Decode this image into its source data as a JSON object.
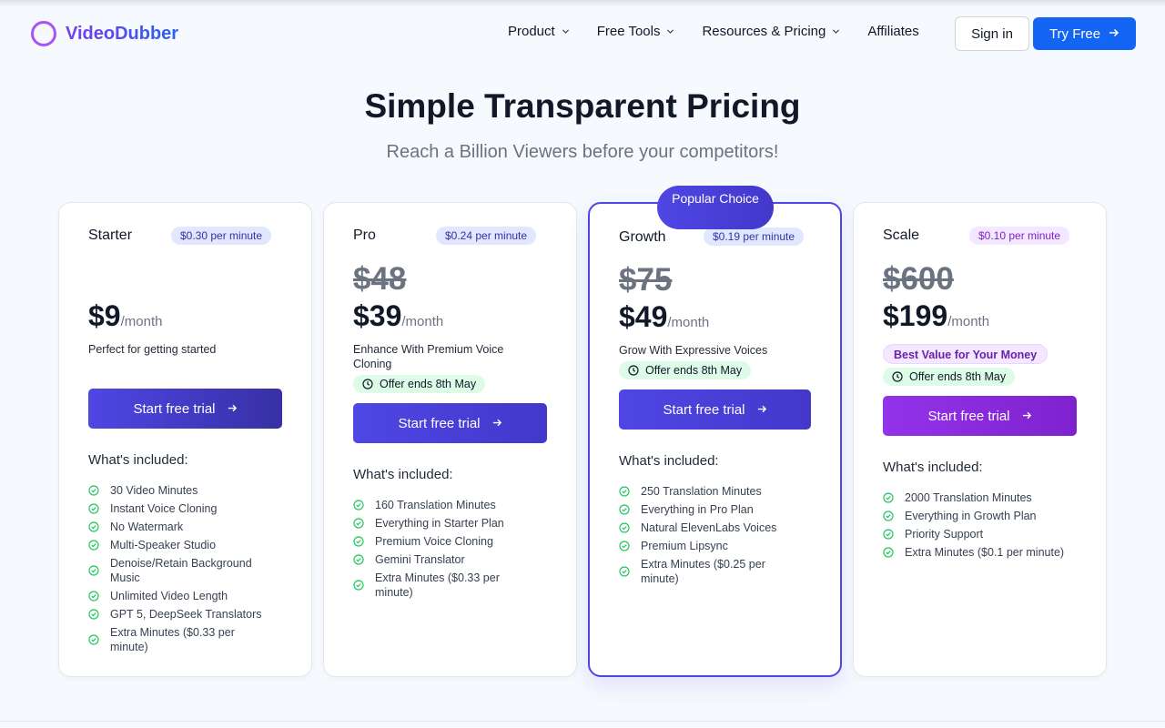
{
  "nav": {
    "logo_text": "VideoDubber",
    "links": [
      {
        "label": "Product",
        "has_dropdown": true
      },
      {
        "label": "Free Tools",
        "has_dropdown": true
      },
      {
        "label": "Resources & Pricing",
        "has_dropdown": true
      },
      {
        "label": "Affiliates",
        "has_dropdown": false
      }
    ],
    "sign_in": "Sign in",
    "try_free": "Try Free"
  },
  "hero": {
    "title": "Simple Transparent Pricing",
    "subtitle": "Reach a Billion Viewers before your competitors!"
  },
  "popular_label": "Popular Choice",
  "plans": [
    {
      "name": "Starter",
      "rate": "$0.30 per minute",
      "old_price": "",
      "price": "$9",
      "period": "/month",
      "tagline": "Perfect for getting started",
      "offer": "",
      "best_value": "",
      "cta": "Start free trial",
      "included_label": "What's included:",
      "features": [
        "30 Video Minutes",
        "Instant Voice Cloning",
        "No Watermark",
        "Multi-Speaker Studio",
        "Denoise/Retain Background Music",
        "Unlimited Video Length",
        "GPT 5, DeepSeek Translators",
        "Extra Minutes ($0.33 per minute)"
      ]
    },
    {
      "name": "Pro",
      "rate": "$0.24 per minute",
      "old_price": "$48",
      "price": "$39",
      "period": "/month",
      "tagline": "Enhance With Premium Voice Cloning",
      "offer": "Offer ends 8th May",
      "best_value": "",
      "cta": "Start free trial",
      "included_label": "What's included:",
      "features": [
        "160 Translation Minutes",
        "Everything in Starter Plan",
        "Premium Voice Cloning",
        "Gemini Translator",
        "Extra Minutes ($0.33 per minute)"
      ]
    },
    {
      "name": "Growth",
      "rate": "$0.19 per minute",
      "old_price": "$75",
      "price": "$49",
      "period": "/month",
      "tagline": "Grow With Expressive Voices",
      "offer": "Offer ends 8th May",
      "best_value": "",
      "cta": "Start free trial",
      "included_label": "What's included:",
      "features": [
        "250 Translation Minutes",
        "Everything in Pro Plan",
        "Natural ElevenLabs Voices",
        "Premium Lipsync",
        "Extra Minutes ($0.25 per minute)"
      ]
    },
    {
      "name": "Scale",
      "rate": "$0.10 per minute",
      "old_price": "$600",
      "price": "$199",
      "period": "/month",
      "tagline": "",
      "offer": "Offer ends 8th May",
      "best_value": "Best Value for Your Money",
      "cta": "Start free trial",
      "included_label": "What's included:",
      "features": [
        "2000 Translation Minutes",
        "Everything in Growth Plan",
        "Priority Support",
        "Extra Minutes ($0.1 per minute)"
      ]
    }
  ],
  "colors": {
    "primary_blue": "#1565f5",
    "indigo": "#4f46e5",
    "purple": "#9333ea",
    "offer_green": "#dcfce7",
    "check_green": "#22c55e"
  }
}
